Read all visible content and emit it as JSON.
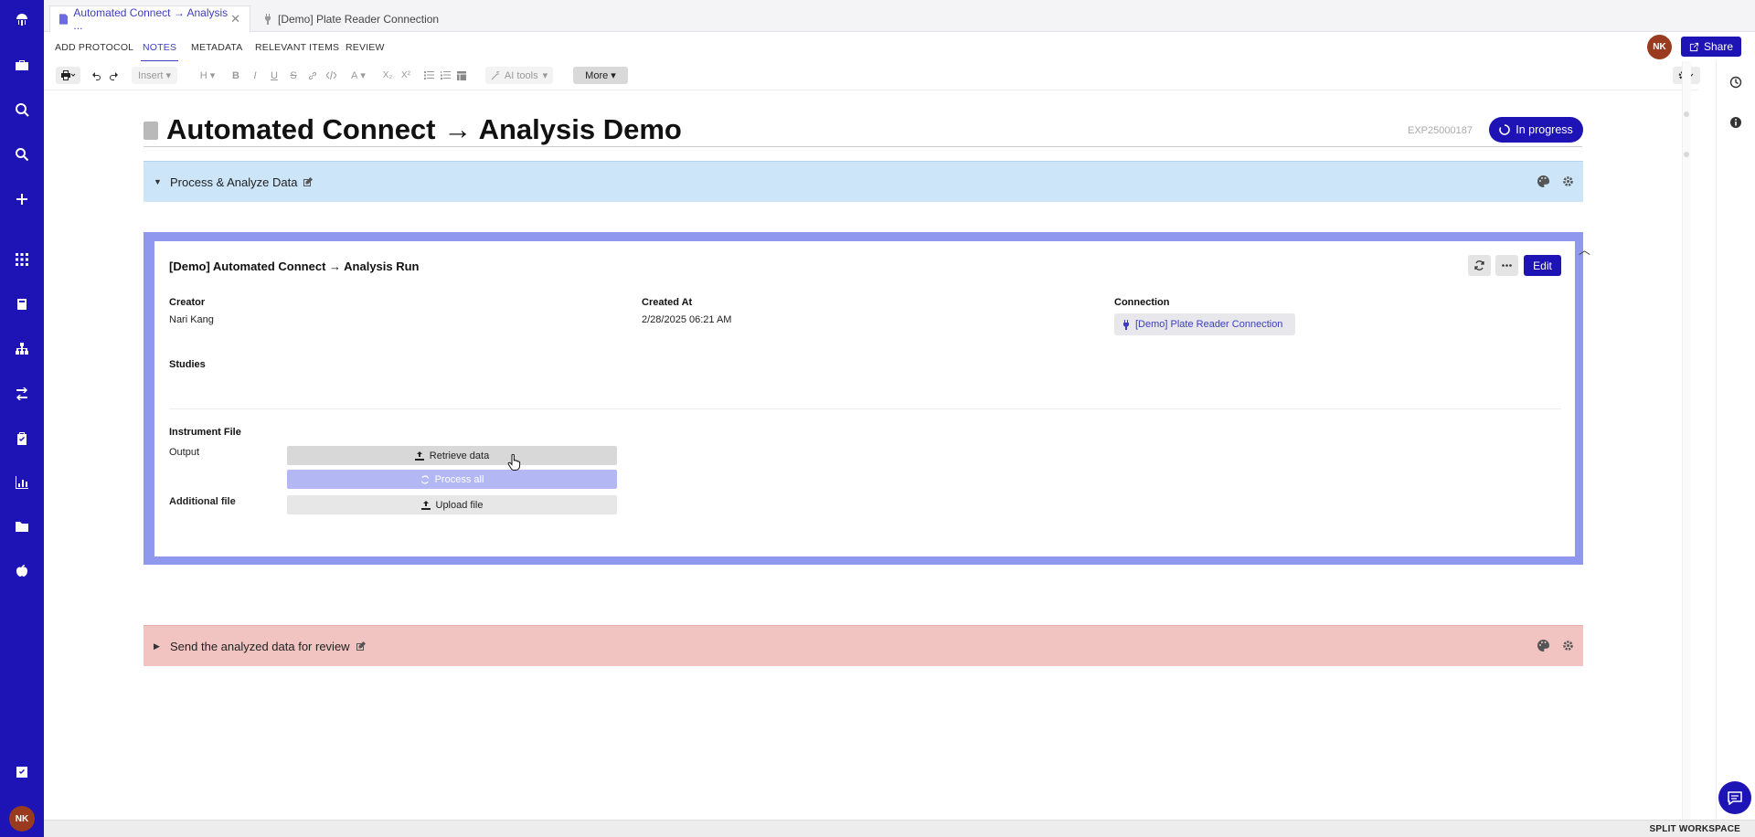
{
  "tabs": [
    {
      "label": "Automated Connect → Analysis ...",
      "close": "✕"
    },
    {
      "label": "[Demo] Plate Reader Connection"
    }
  ],
  "nav": {
    "items": [
      "ADD PROTOCOL",
      "NOTES",
      "METADATA",
      "RELEVANT ITEMS",
      "REVIEW"
    ],
    "active": "NOTES"
  },
  "user": {
    "initials": "NK"
  },
  "share_label": "Share",
  "toolbar": {
    "insert": "Insert",
    "heading": "H",
    "bold": "B",
    "italic": "I",
    "underline": "U",
    "strike": "S",
    "text_color": "A",
    "subscript": "X₂",
    "superscript": "X²",
    "ai_tools": "AI tools",
    "more": "More"
  },
  "document": {
    "title": "Automated Connect → Analysis Demo",
    "exp_id": "EXP25000187",
    "status": "In progress"
  },
  "sections": {
    "process": "Process & Analyze Data",
    "review": "Send the analyzed data for review"
  },
  "run": {
    "title": "[Demo] Automated Connect → Analysis Run",
    "edit_label": "Edit",
    "creator_label": "Creator",
    "creator": "Nari Kang",
    "created_at_label": "Created At",
    "created_at": "2/28/2025 06:21 AM",
    "connection_label": "Connection",
    "connection": "[Demo] Plate Reader Connection",
    "studies_label": "Studies",
    "instrument_label": "Instrument File",
    "output_label": "Output",
    "retrieve": "Retrieve data",
    "process_all": "Process all",
    "additional_label": "Additional file",
    "upload": "Upload file"
  },
  "footer": {
    "split": "SPLIT WORKSPACE"
  },
  "colors": {
    "brand": "#1e14b5",
    "section_blue": "#cce5f8",
    "section_red": "#f1c4c2",
    "card_frame": "#8f98ee"
  }
}
